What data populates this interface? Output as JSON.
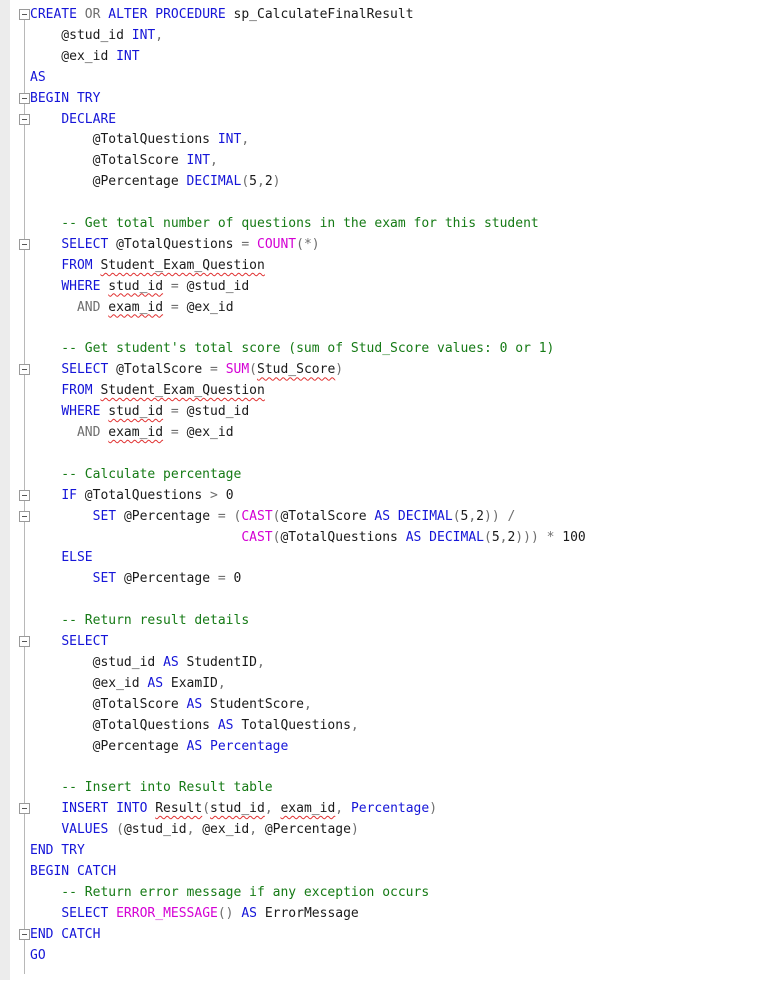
{
  "editor": {
    "language": "T-SQL",
    "lines": [
      [
        [
          "kw",
          "CREATE "
        ],
        [
          "op",
          "OR "
        ],
        [
          "kw",
          "ALTER PROCEDURE "
        ],
        [
          "p",
          "sp_CalculateFinalResult"
        ]
      ],
      [
        [
          "p",
          "    @stud_id "
        ],
        [
          "kw",
          "INT"
        ],
        [
          "op",
          ","
        ]
      ],
      [
        [
          "p",
          "    @ex_id "
        ],
        [
          "kw",
          "INT"
        ]
      ],
      [
        [
          "kw",
          "AS"
        ]
      ],
      [
        [
          "kw",
          "BEGIN TRY"
        ]
      ],
      [
        [
          "p",
          "    "
        ],
        [
          "kw",
          "DECLARE"
        ]
      ],
      [
        [
          "p",
          "        @TotalQuestions "
        ],
        [
          "kw",
          "INT"
        ],
        [
          "op",
          ","
        ]
      ],
      [
        [
          "p",
          "        @TotalScore "
        ],
        [
          "kw",
          "INT"
        ],
        [
          "op",
          ","
        ]
      ],
      [
        [
          "p",
          "        @Percentage "
        ],
        [
          "kw",
          "DECIMAL"
        ],
        [
          "op",
          "("
        ],
        [
          "p",
          "5"
        ],
        [
          "op",
          ","
        ],
        [
          "p",
          "2"
        ],
        [
          "op",
          ")"
        ]
      ],
      [],
      [
        [
          "cm",
          "    -- Get total number of questions in the exam for this student"
        ]
      ],
      [
        [
          "p",
          "    "
        ],
        [
          "kw",
          "SELECT "
        ],
        [
          "p",
          "@TotalQuestions "
        ],
        [
          "op",
          "= "
        ],
        [
          "fn",
          "COUNT"
        ],
        [
          "op",
          "(*)"
        ]
      ],
      [
        [
          "p",
          "    "
        ],
        [
          "kw",
          "FROM "
        ],
        [
          "sq",
          "Student_Exam_Question"
        ]
      ],
      [
        [
          "p",
          "    "
        ],
        [
          "kw",
          "WHERE "
        ],
        [
          "sq",
          "stud_id"
        ],
        [
          "p",
          " "
        ],
        [
          "op",
          "= "
        ],
        [
          "p",
          "@stud_id"
        ]
      ],
      [
        [
          "p",
          "      "
        ],
        [
          "op",
          "AND "
        ],
        [
          "sq",
          "exam_id"
        ],
        [
          "p",
          " "
        ],
        [
          "op",
          "= "
        ],
        [
          "p",
          "@ex_id"
        ]
      ],
      [],
      [
        [
          "cm",
          "    -- Get student's total score (sum of Stud_Score values: 0 or 1)"
        ]
      ],
      [
        [
          "p",
          "    "
        ],
        [
          "kw",
          "SELECT "
        ],
        [
          "p",
          "@TotalScore "
        ],
        [
          "op",
          "= "
        ],
        [
          "fn",
          "SUM"
        ],
        [
          "op",
          "("
        ],
        [
          "sq",
          "Stud_Score"
        ],
        [
          "op",
          ")"
        ]
      ],
      [
        [
          "p",
          "    "
        ],
        [
          "kw",
          "FROM "
        ],
        [
          "sq",
          "Student_Exam_Question"
        ]
      ],
      [
        [
          "p",
          "    "
        ],
        [
          "kw",
          "WHERE "
        ],
        [
          "sq",
          "stud_id"
        ],
        [
          "p",
          " "
        ],
        [
          "op",
          "= "
        ],
        [
          "p",
          "@stud_id"
        ]
      ],
      [
        [
          "p",
          "      "
        ],
        [
          "op",
          "AND "
        ],
        [
          "sq",
          "exam_id"
        ],
        [
          "p",
          " "
        ],
        [
          "op",
          "= "
        ],
        [
          "p",
          "@ex_id"
        ]
      ],
      [],
      [
        [
          "cm",
          "    -- Calculate percentage"
        ]
      ],
      [
        [
          "p",
          "    "
        ],
        [
          "kw",
          "IF "
        ],
        [
          "p",
          "@TotalQuestions "
        ],
        [
          "op",
          "> "
        ],
        [
          "p",
          "0"
        ]
      ],
      [
        [
          "p",
          "        "
        ],
        [
          "kw",
          "SET "
        ],
        [
          "p",
          "@Percentage "
        ],
        [
          "op",
          "= ("
        ],
        [
          "fn",
          "CAST"
        ],
        [
          "op",
          "("
        ],
        [
          "p",
          "@TotalScore "
        ],
        [
          "kw",
          "AS DECIMAL"
        ],
        [
          "op",
          "("
        ],
        [
          "p",
          "5"
        ],
        [
          "op",
          ","
        ],
        [
          "p",
          "2"
        ],
        [
          "op",
          ")) /"
        ]
      ],
      [
        [
          "p",
          "                           "
        ],
        [
          "fn",
          "CAST"
        ],
        [
          "op",
          "("
        ],
        [
          "p",
          "@TotalQuestions "
        ],
        [
          "kw",
          "AS DECIMAL"
        ],
        [
          "op",
          "("
        ],
        [
          "p",
          "5"
        ],
        [
          "op",
          ","
        ],
        [
          "p",
          "2"
        ],
        [
          "op",
          "))) * "
        ],
        [
          "p",
          "100"
        ]
      ],
      [
        [
          "p",
          "    "
        ],
        [
          "kw",
          "ELSE"
        ]
      ],
      [
        [
          "p",
          "        "
        ],
        [
          "kw",
          "SET "
        ],
        [
          "p",
          "@Percentage "
        ],
        [
          "op",
          "= "
        ],
        [
          "p",
          "0"
        ]
      ],
      [],
      [
        [
          "cm",
          "    -- Return result details"
        ]
      ],
      [
        [
          "p",
          "    "
        ],
        [
          "kw",
          "SELECT"
        ]
      ],
      [
        [
          "p",
          "        @stud_id "
        ],
        [
          "kw",
          "AS "
        ],
        [
          "p",
          "StudentID"
        ],
        [
          "op",
          ","
        ]
      ],
      [
        [
          "p",
          "        @ex_id "
        ],
        [
          "kw",
          "AS "
        ],
        [
          "p",
          "ExamID"
        ],
        [
          "op",
          ","
        ]
      ],
      [
        [
          "p",
          "        @TotalScore "
        ],
        [
          "kw",
          "AS "
        ],
        [
          "p",
          "StudentScore"
        ],
        [
          "op",
          ","
        ]
      ],
      [
        [
          "p",
          "        @TotalQuestions "
        ],
        [
          "kw",
          "AS "
        ],
        [
          "p",
          "TotalQuestions"
        ],
        [
          "op",
          ","
        ]
      ],
      [
        [
          "p",
          "        @Percentage "
        ],
        [
          "kw",
          "AS Percentage"
        ]
      ],
      [],
      [
        [
          "cm",
          "    -- Insert into Result table"
        ]
      ],
      [
        [
          "p",
          "    "
        ],
        [
          "kw",
          "INSERT INTO "
        ],
        [
          "sq",
          "Result"
        ],
        [
          "op",
          "("
        ],
        [
          "sq",
          "stud_id"
        ],
        [
          "op",
          ", "
        ],
        [
          "sq",
          "exam_id"
        ],
        [
          "op",
          ", "
        ],
        [
          "kw",
          "Percentage"
        ],
        [
          "op",
          ")"
        ]
      ],
      [
        [
          "p",
          "    "
        ],
        [
          "kw",
          "VALUES "
        ],
        [
          "op",
          "("
        ],
        [
          "p",
          "@stud_id"
        ],
        [
          "op",
          ", "
        ],
        [
          "p",
          "@ex_id"
        ],
        [
          "op",
          ", "
        ],
        [
          "p",
          "@Percentage"
        ],
        [
          "op",
          ")"
        ]
      ],
      [
        [
          "kw",
          "END TRY"
        ]
      ],
      [
        [
          "kw",
          "BEGIN CATCH"
        ]
      ],
      [
        [
          "cm",
          "    -- Return error message if any exception occurs"
        ]
      ],
      [
        [
          "p",
          "    "
        ],
        [
          "kw",
          "SELECT "
        ],
        [
          "fn",
          "ERROR_MESSAGE"
        ],
        [
          "op",
          "() "
        ],
        [
          "kw",
          "AS "
        ],
        [
          "p",
          "ErrorMessage"
        ]
      ],
      [
        [
          "kw",
          "END CATCH"
        ]
      ],
      [
        [
          "kw",
          "GO"
        ]
      ]
    ],
    "fold_markers": [
      0,
      4,
      5,
      11,
      17,
      23,
      24,
      30,
      38,
      44
    ],
    "colors": {
      "keyword": "#1515d8",
      "function": "#d400d4",
      "comment": "#157a15",
      "operator": "#6e6e6e",
      "plain": "#1a1a1a",
      "squiggle": "#e03030",
      "gutter": "#ececec"
    }
  }
}
